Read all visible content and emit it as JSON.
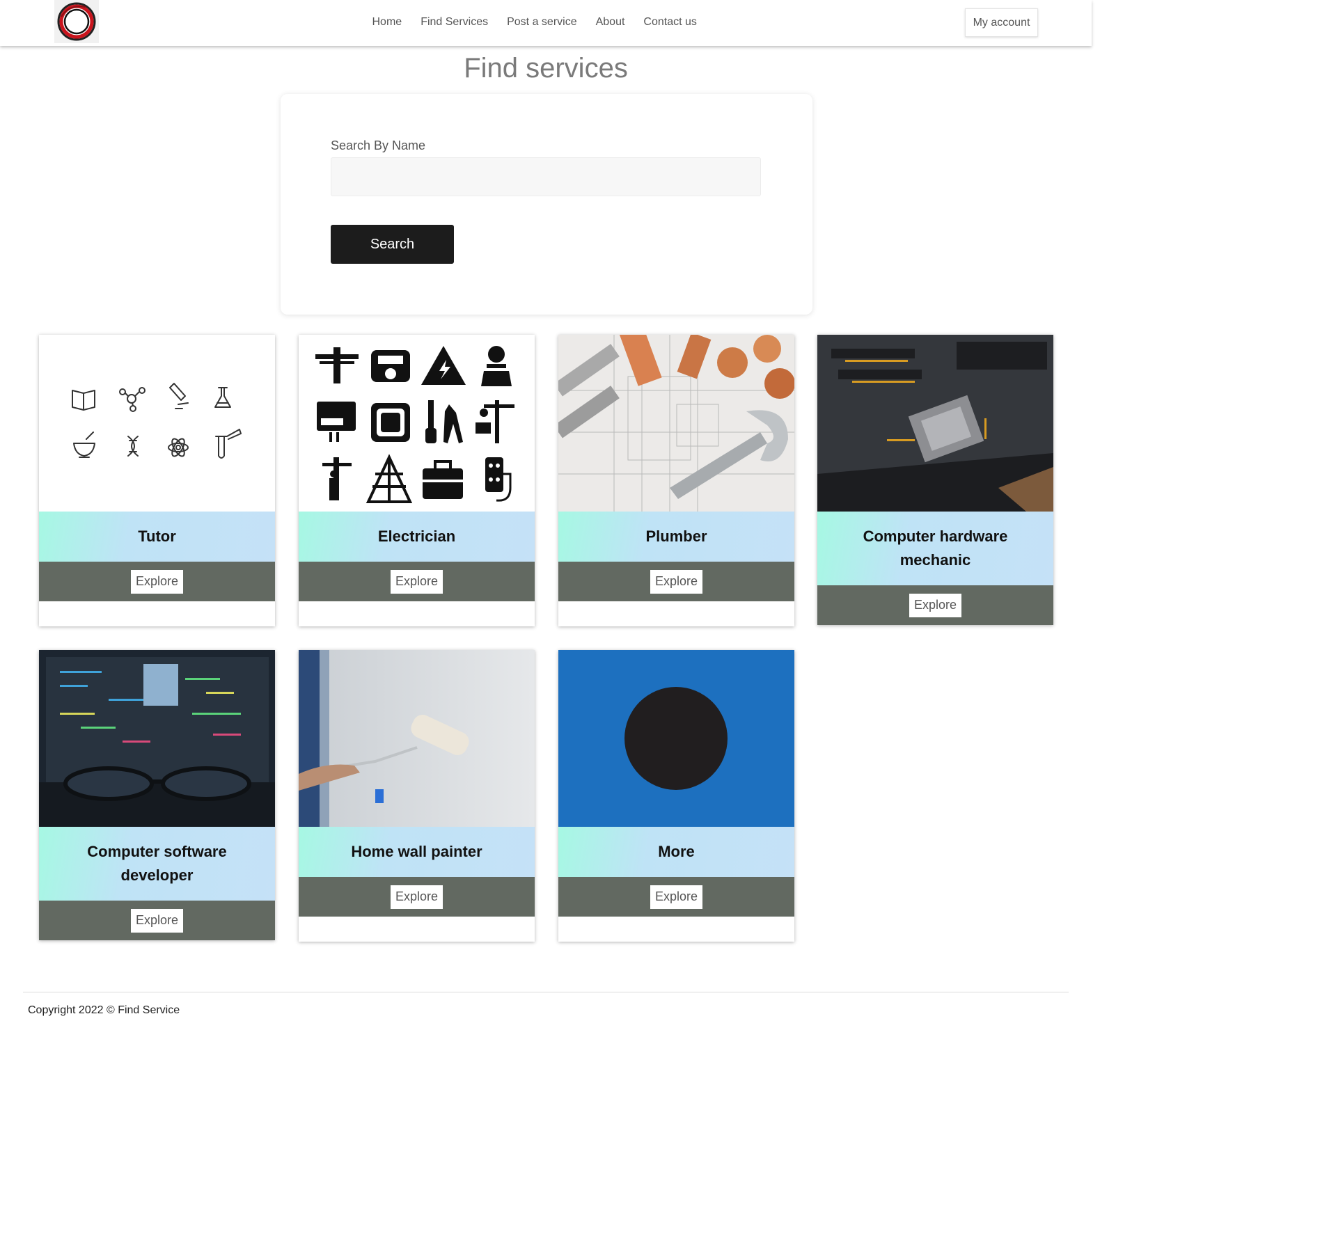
{
  "nav": {
    "links": [
      "Home",
      "Find Services",
      "Post a service",
      "About",
      "Contact us"
    ],
    "account_label": "My account"
  },
  "page": {
    "title": "Find services"
  },
  "search": {
    "label": "Search By Name",
    "value": "",
    "placeholder": "",
    "button_label": "Search"
  },
  "cards": [
    {
      "title": "Tutor",
      "button": "Explore",
      "image": "science-icons-grid"
    },
    {
      "title": "Electrician",
      "button": "Explore",
      "image": "electrician-icons-grid"
    },
    {
      "title": "Plumber",
      "button": "Explore",
      "image": "pipes-and-wrench-photo"
    },
    {
      "title": "Computer hardware mechanic",
      "button": "Explore",
      "image": "motherboard-photo"
    },
    {
      "title": "Computer software developer",
      "button": "Explore",
      "image": "code-monitor-glasses-photo"
    },
    {
      "title": "Home wall painter",
      "button": "Explore",
      "image": "paint-roller-photo"
    },
    {
      "title": "More",
      "button": "Explore",
      "image": "dark-circle-on-blue"
    }
  ],
  "footer": {
    "copyright": "Copyright 2022 © Find Service"
  },
  "colors": {
    "card_title_gradient_start": "#a6f8e3",
    "card_title_gradient_end": "#c5e1f7",
    "card_footer": "#626961",
    "search_button": "#1c1c1c",
    "more_card_bg": "#1d70bf"
  }
}
